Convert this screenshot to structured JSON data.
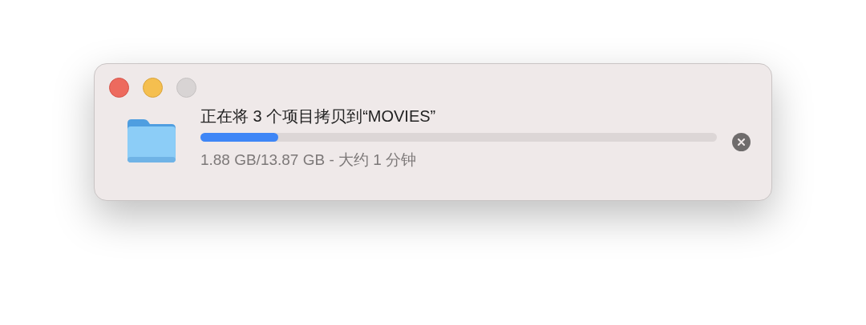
{
  "window_controls": [
    {
      "kind": "close",
      "disabled": false
    },
    {
      "kind": "minimize",
      "disabled": false
    },
    {
      "kind": "zoom",
      "disabled": true
    }
  ],
  "copy_task": {
    "title": "正在将 3 个项目拷贝到“MOVIES”",
    "level": 0.15,
    "status": "1.88 GB/13.87 GB - 大约 1 分钟"
  }
}
